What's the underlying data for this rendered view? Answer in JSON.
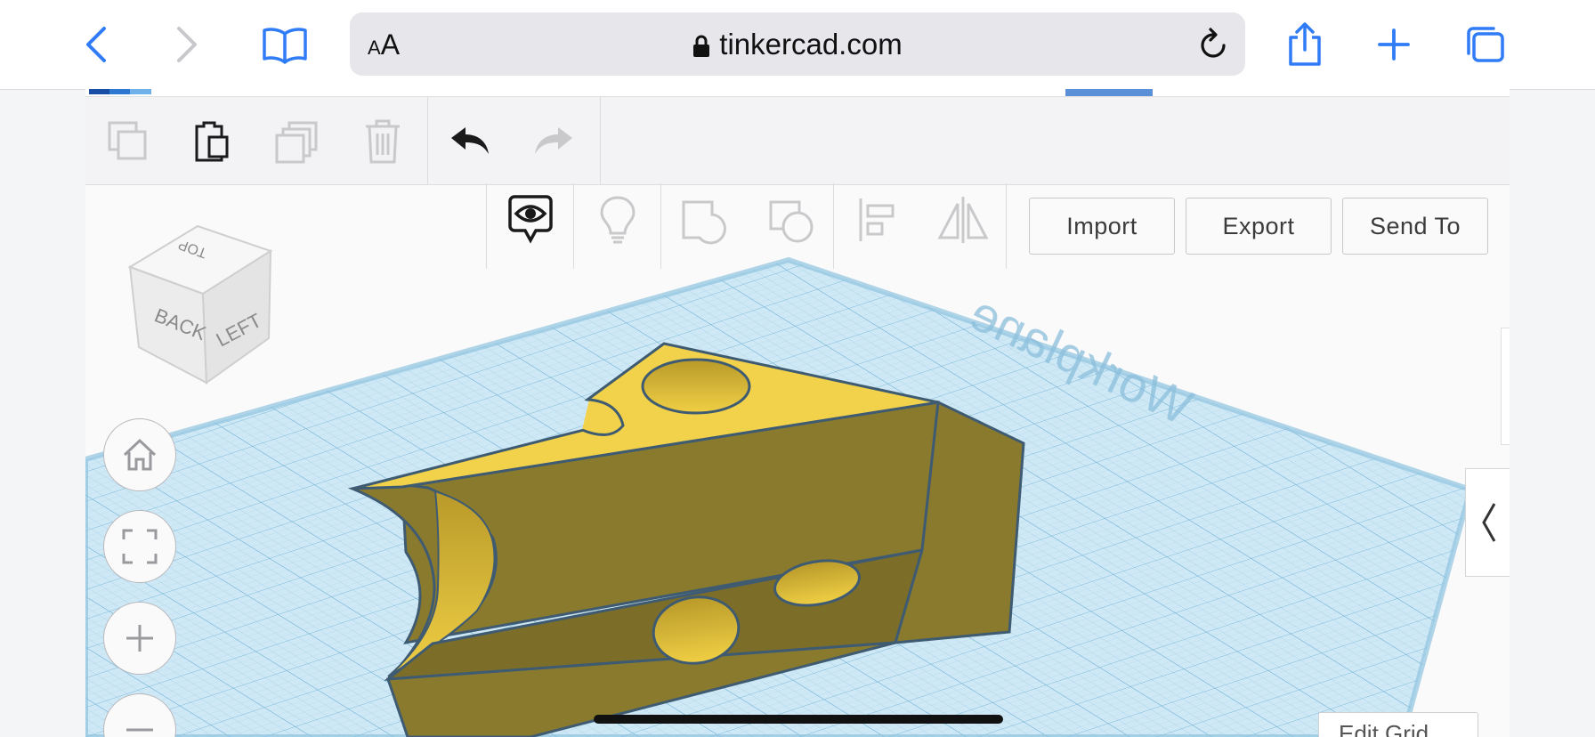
{
  "browser": {
    "text_size_label_small": "A",
    "text_size_label_large": "A",
    "url": "tinkercad.com"
  },
  "toolbar": {
    "import_label": "Import",
    "export_label": "Export",
    "send_to_label": "Send To"
  },
  "viewcube": {
    "top": "TOP",
    "back": "BACK",
    "left": "LEFT"
  },
  "workplane": {
    "label": "Workplane"
  },
  "edit_grid_label": "Edit Grid",
  "colors": {
    "cheese_top": "#f2d24a",
    "cheese_side": "#8a7a2d",
    "grid": "#bfe0f1",
    "accent": "#5b8fd8"
  }
}
